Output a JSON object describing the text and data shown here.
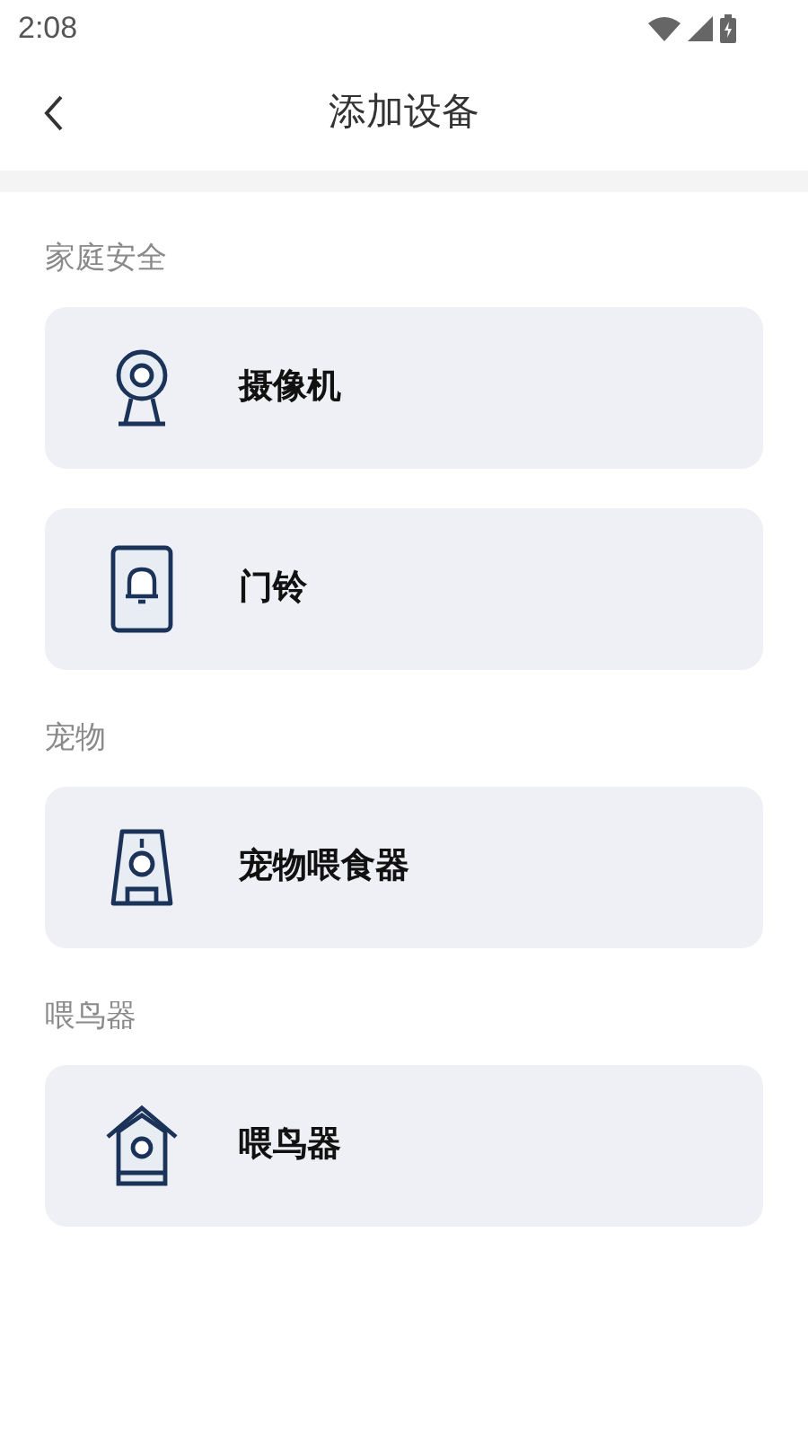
{
  "status_bar": {
    "time": "2:08"
  },
  "header": {
    "title": "添加设备"
  },
  "sections": [
    {
      "title": "家庭安全",
      "devices": [
        {
          "kind": "camera",
          "label": "摄像机"
        },
        {
          "kind": "doorbell",
          "label": "门铃"
        }
      ]
    },
    {
      "title": "宠物",
      "devices": [
        {
          "kind": "feeder",
          "label": "宠物喂食器"
        }
      ]
    },
    {
      "title": "喂鸟器",
      "devices": [
        {
          "kind": "birdhouse",
          "label": "喂鸟器"
        }
      ]
    }
  ]
}
